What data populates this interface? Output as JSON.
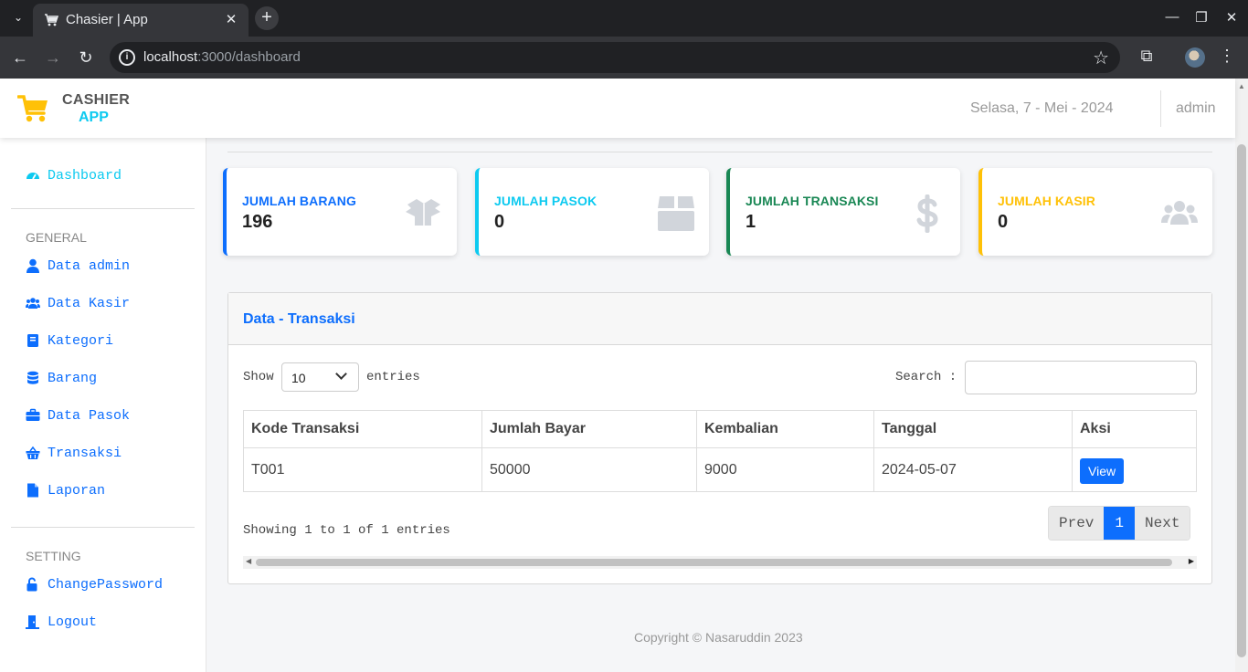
{
  "browser": {
    "tab_title": "Chasier | App",
    "url_host": "localhost",
    "url_rest": ":3000/dashboard"
  },
  "header": {
    "brand_line1": "CASHIER",
    "brand_line2": "APP",
    "date": "Selasa, 7 - Mei - 2024",
    "user": "admin"
  },
  "sidebar": {
    "dashboard": "Dashboard",
    "general_heading": "GENERAL",
    "items": [
      "Data admin",
      "Data Kasir",
      "Kategori",
      "Barang",
      "Data Pasok",
      "Transaksi",
      "Laporan"
    ],
    "setting_heading": "SETTING",
    "settings": [
      "ChangePassword",
      "Logout"
    ]
  },
  "cards": [
    {
      "label": "JUMLAH BARANG",
      "value": "196",
      "color": "#0d6efd",
      "icon": "box-open-icon"
    },
    {
      "label": "JUMLAH PASOK",
      "value": "0",
      "color": "#0dcaf0",
      "icon": "box-icon"
    },
    {
      "label": "JUMLAH TRANSAKSI",
      "value": "1",
      "color": "#198754",
      "icon": "dollar-icon"
    },
    {
      "label": "JUMLAH KASIR",
      "value": "0",
      "color": "#ffc107",
      "icon": "users-icon"
    }
  ],
  "panel": {
    "title": "Data - Transaksi",
    "show_label": "Show",
    "page_size": "10",
    "entries_label": "entries",
    "search_label": "Search :",
    "search_value": "",
    "columns": [
      "Kode Transaksi",
      "Jumlah Bayar",
      "Kembalian",
      "Tanggal",
      "Aksi"
    ],
    "rows": [
      {
        "kode": "T001",
        "bayar": "50000",
        "kembalian": "9000",
        "tanggal": "2024-05-07",
        "aksi": "View"
      }
    ],
    "showing": "Showing 1 to 1 of 1 entries",
    "prev": "Prev",
    "page": "1",
    "next": "Next"
  },
  "footer": "Copyright © Nasaruddin 2023"
}
